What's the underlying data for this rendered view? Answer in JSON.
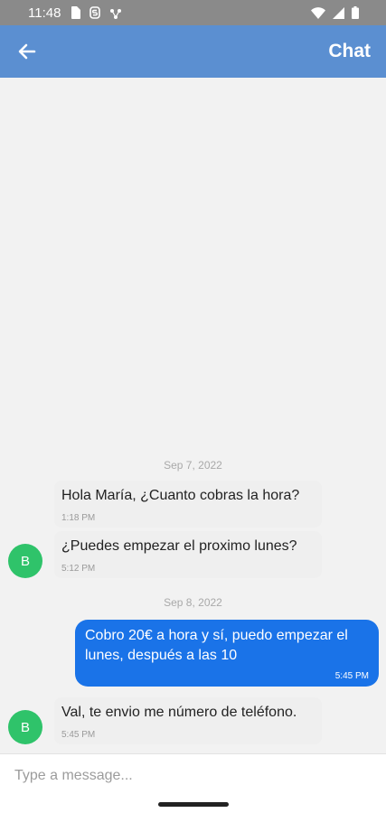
{
  "status_bar": {
    "time": "11:48",
    "icons_left": [
      "sim-card-icon",
      "s-icon",
      "network-icon"
    ],
    "icons_right": [
      "wifi-icon",
      "signal-icon",
      "battery-icon"
    ]
  },
  "header": {
    "title": "Chat",
    "back_icon": "arrow-left-icon",
    "color": "#5b8fd1"
  },
  "chat": {
    "date_1": "Sep 7, 2022",
    "date_2": "Sep 8, 2022",
    "messages": [
      {
        "sender": "B",
        "text": "Hola María, ¿Cuanto cobras la hora?",
        "time": "1:18 PM",
        "direction": "incoming"
      },
      {
        "sender": "B",
        "text": "¿Puedes empezar el proximo lunes?",
        "time": "5:12 PM",
        "direction": "incoming"
      },
      {
        "sender": "me",
        "text": "Cobro 20€ a hora y sí, puedo empezar el lunes, después a las 10",
        "time": "5:45 PM",
        "direction": "outgoing"
      },
      {
        "sender": "B",
        "text": "Val, te envio me número de teléfono.",
        "time": "5:45 PM",
        "direction": "incoming"
      }
    ],
    "avatar_color": "#2fc36a",
    "outgoing_color": "#1a73e8"
  },
  "composer": {
    "placeholder": "Type a message..."
  }
}
